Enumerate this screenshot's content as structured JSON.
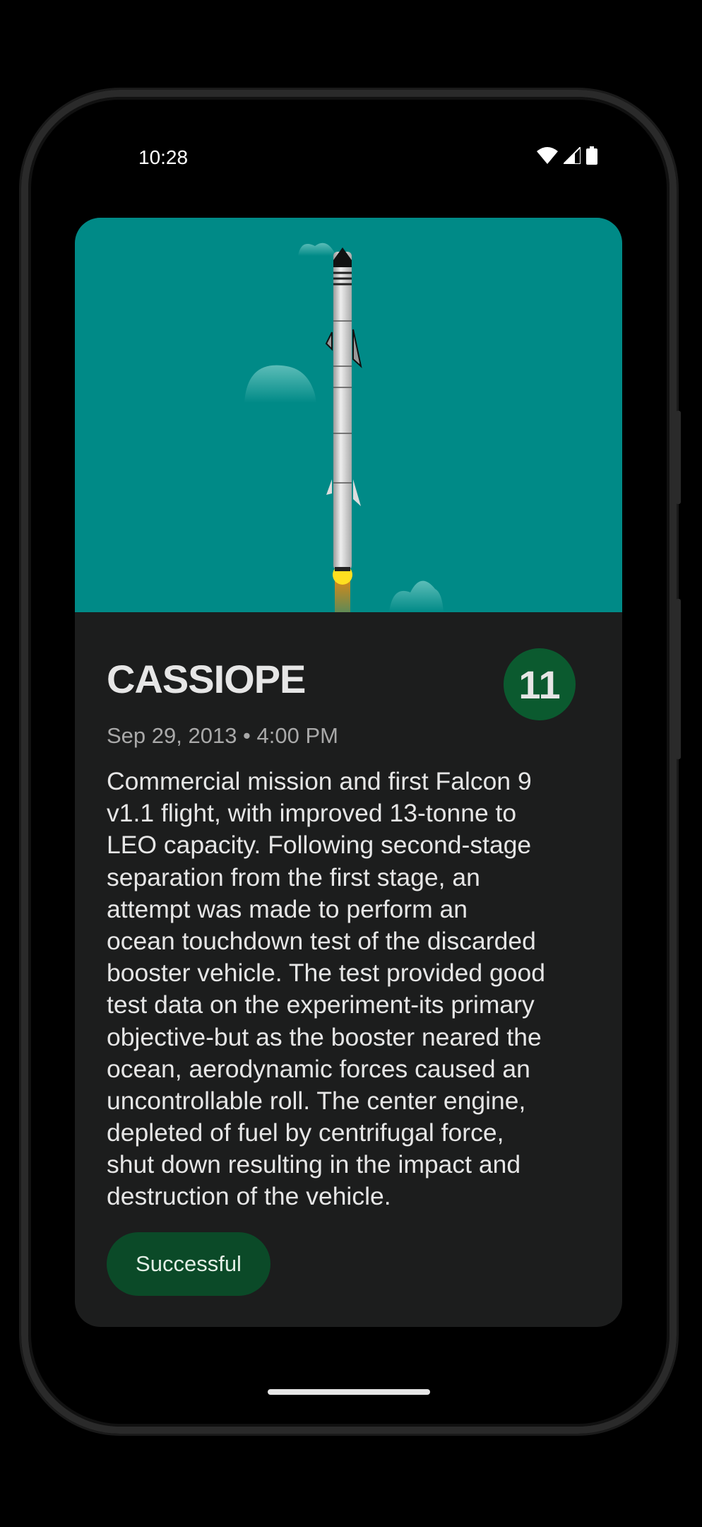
{
  "status_bar": {
    "time": "10:28",
    "icons": [
      "wifi-icon",
      "signal-icon",
      "battery-icon"
    ]
  },
  "launch": {
    "name": "CASSIOPE",
    "flight_number": "11",
    "date": "Sep 29, 2013 • 4:00 PM",
    "description_lines": [
      "Commercial mission and first Falcon 9",
      "v1.1 flight, with improved 13-tonne to",
      "LEO capacity. Following second-stage",
      "separation from the first stage, an",
      "attempt was made to perform an",
      "ocean touchdown test of the discarded",
      "booster vehicle. The test provided good",
      "test data on the experiment-its primary",
      "objective-but as the booster neared the",
      "ocean, aerodynamic forces caused an",
      "uncontrollable roll. The center engine,",
      "depleted of fuel by centrifugal force,",
      "shut down resulting in the impact and",
      "destruction of the vehicle."
    ],
    "status": "Successful"
  },
  "colors": {
    "hero": "#008a87",
    "card": "#1c1d1d",
    "success": "#0b5a2f"
  }
}
